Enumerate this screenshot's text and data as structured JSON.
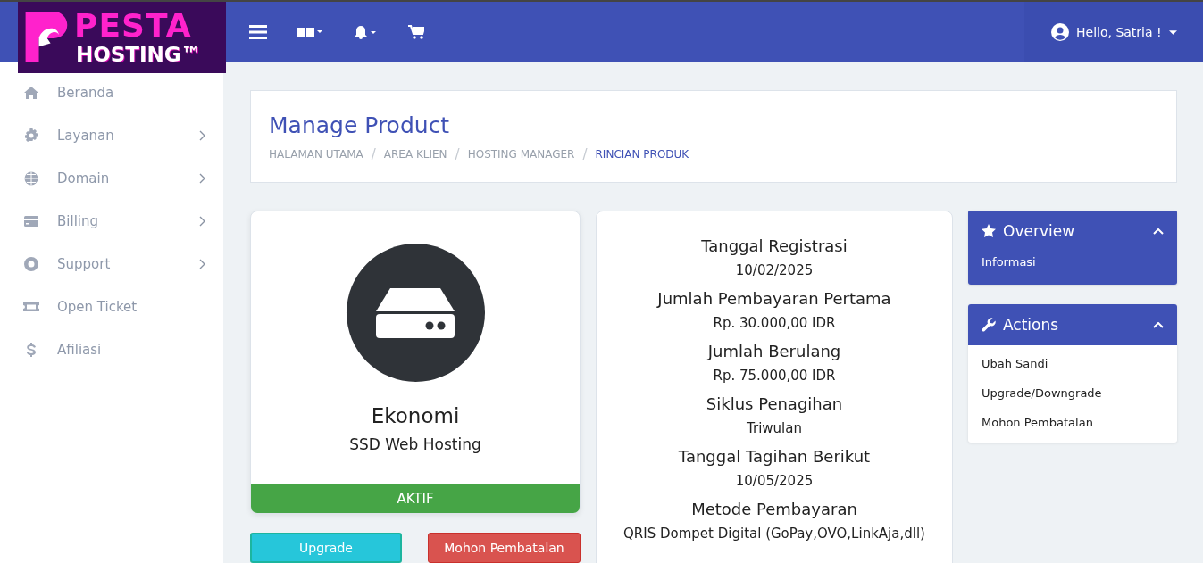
{
  "logo": {
    "line_1": "PESTA",
    "line_2": "HOSTING™"
  },
  "topbar": {
    "user_greeting": "Hello, Satria !"
  },
  "sidebar": {
    "items": [
      {
        "label": "Beranda",
        "has_submenu": false
      },
      {
        "label": "Layanan",
        "has_submenu": true
      },
      {
        "label": "Domain",
        "has_submenu": true
      },
      {
        "label": "Billing",
        "has_submenu": true
      },
      {
        "label": "Support",
        "has_submenu": true
      },
      {
        "label": "Open Ticket",
        "has_submenu": false
      },
      {
        "label": "Afiliasi",
        "has_submenu": false
      }
    ]
  },
  "page_header": {
    "title": "Manage Product",
    "separators": [
      "/",
      "/",
      "/"
    ],
    "breadcrumb": [
      {
        "label": "HALAMAN UTAMA",
        "active": false
      },
      {
        "label": "AREA KLIEN",
        "active": false
      },
      {
        "label": "HOSTING MANAGER",
        "active": false
      },
      {
        "label": "RINCIAN PRODUK",
        "active": true
      }
    ]
  },
  "product": {
    "name": "Ekonomi",
    "group": "SSD Web Hosting",
    "status": "AKTIF"
  },
  "product_buttons": [
    {
      "label": "Upgrade",
      "kind": "info"
    },
    {
      "label": "Mohon Pembatalan",
      "kind": "danger"
    }
  ],
  "details": [
    {
      "label": "Tanggal Registrasi",
      "value": "10/02/2025"
    },
    {
      "label": "Jumlah Pembayaran Pertama",
      "value": "Rp. 30.000,00 IDR"
    },
    {
      "label": "Jumlah Berulang",
      "value": "Rp. 75.000,00 IDR"
    },
    {
      "label": "Siklus Penagihan",
      "value": "Triwulan"
    },
    {
      "label": "Tanggal Tagihan Berikut",
      "value": "10/05/2025"
    },
    {
      "label": "Metode Pembayaran",
      "value": "QRIS Dompet Digital (GoPay,OVO,LinkAja,dll)"
    }
  ],
  "panels": [
    {
      "title": "Overview",
      "expanded": true,
      "kind": "filled",
      "items": [
        "Informasi"
      ]
    },
    {
      "title": "Actions",
      "expanded": true,
      "kind": "plain",
      "items": [
        "Ubah Sandi",
        "Upgrade/Downgrade",
        "Mohon Pembatalan"
      ]
    }
  ]
}
